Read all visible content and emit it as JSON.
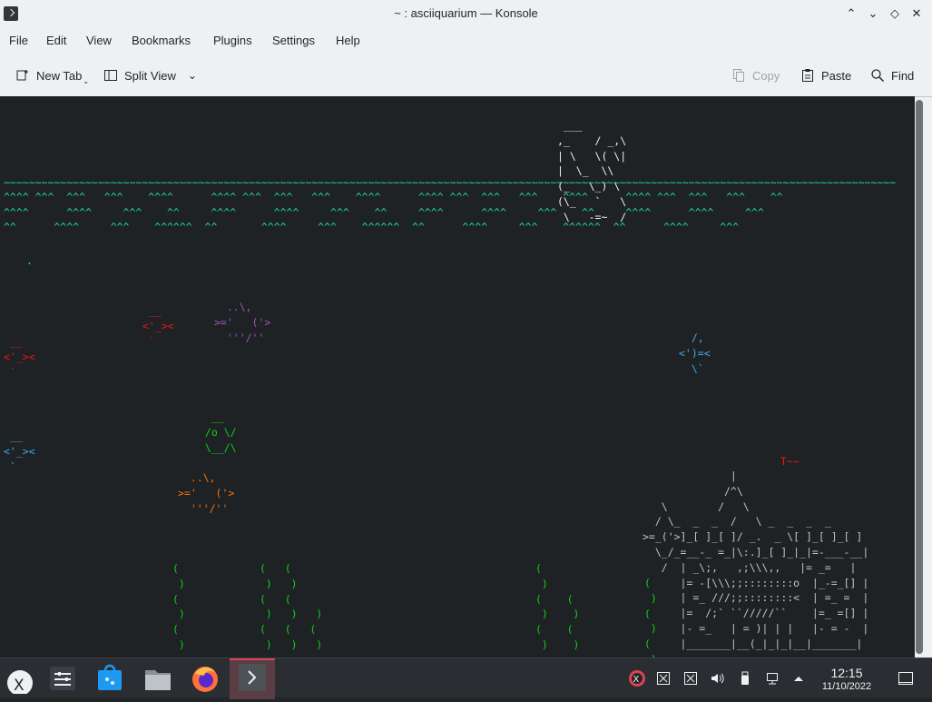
{
  "window": {
    "title": "~ : asciiquarium — Konsole",
    "controls": {
      "keep_above": "⌃",
      "minimize": "⌄",
      "maximize": "◇",
      "close": "✕"
    }
  },
  "menubar": [
    "File",
    "Edit",
    "View",
    "Bookmarks",
    "Plugins",
    "Settings",
    "Help"
  ],
  "toolbar": {
    "new_tab": "New Tab",
    "split_view": "Split View",
    "copy": "Copy",
    "paste": "Paste",
    "find": "Find"
  },
  "terminal": {
    "colors": {
      "background": "#1f2225",
      "water": "#1cdc9a",
      "fish_blue": "#3daee9",
      "fish_red": "#ed1515",
      "fish_orange": "#f67400",
      "fish_purple": "#9b59b6",
      "fish_yellow": "#fdbc4b",
      "castle": "#bdc3c7",
      "seaweed": "#11d116"
    },
    "ship": " ___\n,_    / _,\\\n| \\   \\( \\|\n|  \\_  \\\\\n(_   \\_) \\\n(\\_   `   \\\n \\   -=~  /",
    "water_line_1": "~~~~~~~~~~~~~~~~~~~~~~~~~~~~~~~~~~~~~~~~~~~~~~~~~~~~~~~~~~~~~~~~~~~~~~~~~~~~~~~~~~~~~~~~~~~~~~~~~~~~~~~~~~~~~~~~~~~~~~~~~~~~~~~~~~~~~~~~~~~~~~",
    "water_line_2": "^^^^ ^^^  ^^^   ^^^    ^^^^      ^^^^ ^^^  ^^^   ^^^    ^^^^      ^^^^ ^^^  ^^^   ^^^    ^^^^      ^^^^ ^^^  ^^^   ^^^    ^^",
    "water_line_3": "^^^^      ^^^^     ^^^    ^^     ^^^^      ^^^^     ^^^    ^^     ^^^^      ^^^^     ^^^    ^^     ^^^^      ^^^^     ^^^",
    "water_line_4": "^^      ^^^^     ^^^    ^^^^^^  ^^       ^^^^     ^^^    ^^^^^^  ^^      ^^^^     ^^^    ^^^^^^  ^^      ^^^^     ^^^",
    "bubble": ".",
    "fish_1": " __\n<'_><\n `",
    "fish_2": "  ..\\,\n>='   ('>\n  '''/''",
    "fish_3": " __\n<'_><\n `",
    "fish_4": "  /,\n<')=<\n  \\`",
    "fish_5": "  __\n /o \\/\n \\__/\\",
    "fish_6": " __\n<'_><\n `",
    "fish_7": "  ..\\,\n>='   ('>\n  '''/''",
    "castle_flag": "T~~",
    "castle": "              |\n             /^\\\n   \\        /   \\\n  / \\_  _  _  /   \\ _  _  _  _\n>=_('>]_[ ]_[ ]/ _.  _ \\[ ]_[ ]_[ ]\n  \\_/_=__-_ =_|\\:.]_[ ]_|_|=-___-__|\n   /  | _\\;,   ,;\\\\\\,,   |= _=   |\n      |= -[\\\\\\;;::::::::o  |_-=_[] |\n      | =_ ///;;::::::::<  | =_ =  |\n      |=  /;` ``/////``    |=_ =[] |\n      |- =_   | = )| | |   |- = -  |\n      |_______|__(_|_|_|__|_______|",
    "weed_1": "(\n )\n(\n )\n(\n )",
    "weed_2": "(   (\n )   )\n(   (\n )   )   )\n(   (   (\n )   )   )",
    "weed_3": "(\n )\n(    (\n )    )\n(    (\n )    )",
    "weed_4": "(\n )\n(\n )\n(\n )"
  },
  "taskbar": {
    "apps": [
      "application-launcher-icon",
      "system-settings-icon",
      "discover-store-icon",
      "dolphin-file-manager-icon",
      "firefox-icon",
      "konsole-icon"
    ],
    "tray": [
      "xcreensaver-icon",
      "display-icon",
      "display-2-icon",
      "volume-icon",
      "usb-device-icon",
      "network-icon",
      "show-hidden-icon"
    ],
    "clock_time": "12:15",
    "clock_date": "11/10/2022"
  }
}
